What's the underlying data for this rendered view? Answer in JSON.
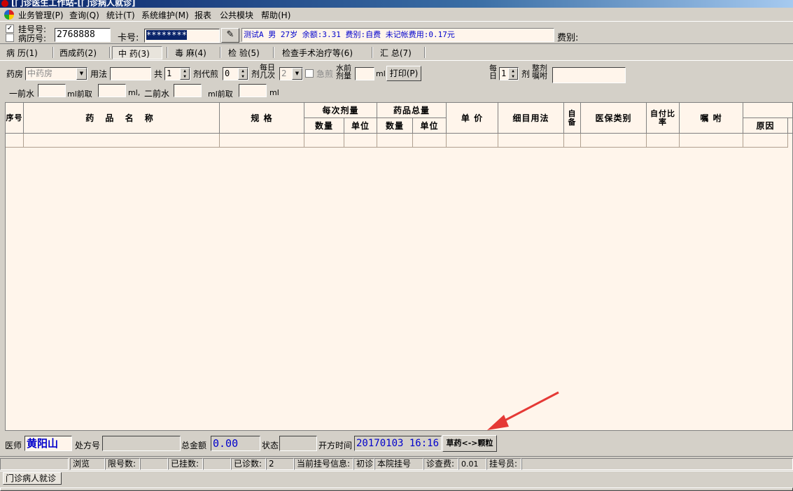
{
  "window": {
    "title": "[门诊医生工作站-[门诊病人就诊]"
  },
  "menu": [
    "业务管理(P)",
    "查询(Q)",
    "统计(T)",
    "系统维护(M)",
    "报表",
    "公共模块",
    "帮助(H)"
  ],
  "patient": {
    "register_label": "挂号号:",
    "record_label": "病历号:",
    "register_checked": "✓",
    "number_value": "2768888",
    "card_label": "卡号:",
    "card_value": "********",
    "info": "测试A  男  27岁  余额:3.31  费别:自费  未记帐费用:0.17元",
    "fee_label": "费别:"
  },
  "tabs": [
    "病 历(1)",
    "西成药(2)",
    "中 药(3)",
    "毒 麻(4)",
    "检 验(5)",
    "检查手术治疗等(6)",
    "汇 总(7)"
  ],
  "active_tab": 2,
  "form": {
    "pharmacy_label": "药房",
    "pharmacy_value": "中药房",
    "usage_label": "用法",
    "total_label": "共",
    "total_value": "1",
    "dose_decoct_label": "剂代煎",
    "dose_decoct_value": "0",
    "unit_ji": "剂",
    "daily_times_label": "每日几次",
    "daily_times_value": "2",
    "urgent_label": "急煎",
    "water_dose_label": "水前剂量",
    "ml": "ml",
    "print_button": "打印(P)",
    "per_day_label": "每日",
    "per_day_value": "1",
    "per_day_unit": "剂",
    "whole_dose_label": "整剂嘱咐",
    "first_decoct_water": "一前水",
    "ml_take": "ml前取",
    "ml_comma": "ml,",
    "second_decoct_water": "二前水"
  },
  "table": {
    "headers": {
      "seq": "序号",
      "name": "药 品 名 称",
      "spec": "规  格",
      "per_dose": "每次剂量",
      "total_qty": "药品总量",
      "qty": "数量",
      "unit": "单位",
      "qty2": "数量",
      "unit2": "单位",
      "price": "单 价",
      "usage": "细目用法",
      "self_prep": "自备",
      "insurance": "医保类别",
      "self_pay": "自付比率",
      "instruction": "嘱 咐",
      "reason": "原因"
    }
  },
  "bottom": {
    "doctor_label": "医师",
    "doctor_value": "黄阳山",
    "rx_label": "处方号",
    "total_label": "总金额",
    "total_value": "0.00",
    "state_label": "状态",
    "time_label": "开方时间",
    "time_value": "20170103 16:16",
    "switch_button": "草药<->颗粒"
  },
  "statusbar": {
    "browse": "浏览",
    "limit": "限号数:",
    "registered": "已挂数:",
    "diagnosed": "已诊数:",
    "diagnosed_value": "2",
    "current_info": "当前挂号信息:",
    "first_visit": "初诊",
    "hospital_reg": "本院挂号",
    "fee": "诊查费:",
    "fee_value": "0.01",
    "registrar": "挂号员:"
  },
  "taskbar": {
    "task": "门诊病人就诊"
  },
  "colors": {
    "grid_bg": "#fff5eb",
    "info_text": "#0000cc",
    "title_bar": "#0a246a",
    "arrow": "#e53935"
  }
}
